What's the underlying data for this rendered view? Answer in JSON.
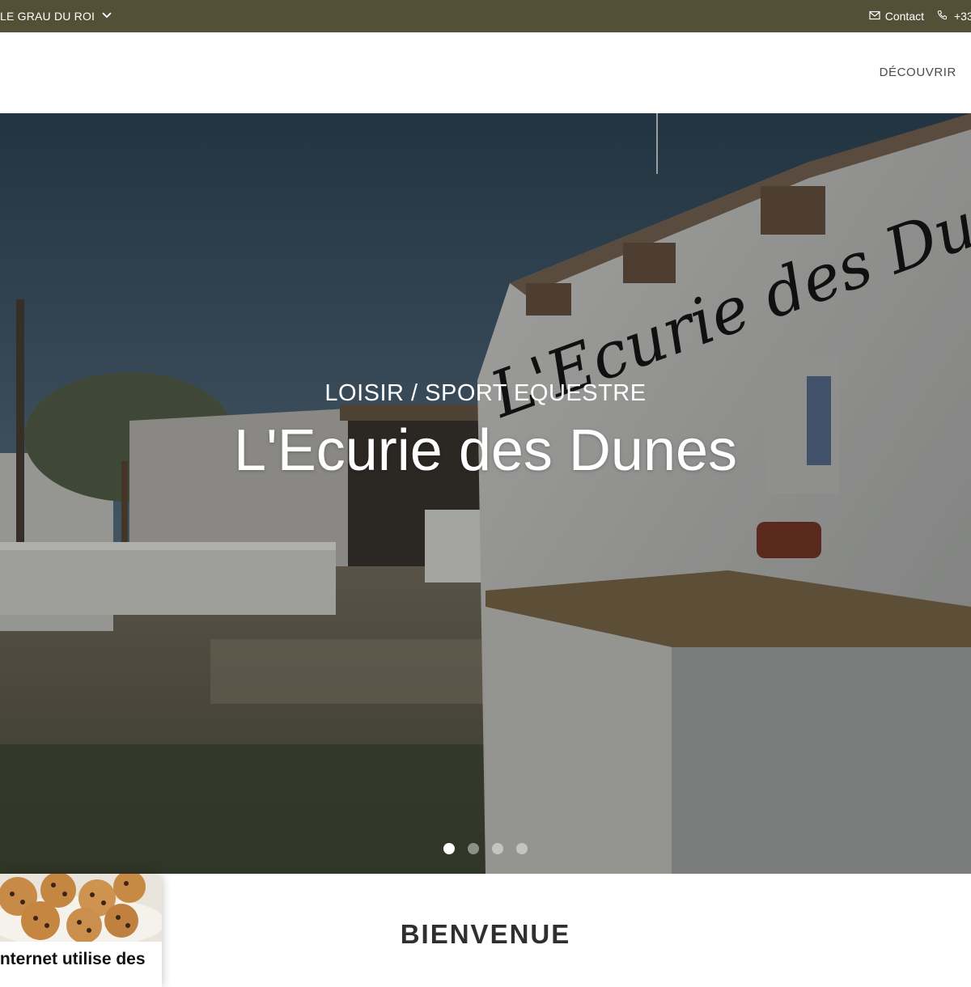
{
  "topbar": {
    "location_label": "LE GRAU DU ROI",
    "contact_label": "Contact",
    "phone_label": "+33"
  },
  "nav": {
    "discover_label": "DÉCOUVRIR"
  },
  "hero": {
    "kicker": "LOISIR / SPORT EQUESTRE",
    "title": "L'Ecurie des Dunes",
    "wall_sign": "L'Ecurie des Dunes",
    "slides": 4,
    "active_slide": 1
  },
  "section": {
    "welcome_title": "BIENVENUE"
  },
  "cookie_banner": {
    "text": "Internet utilise des"
  },
  "colors": {
    "topbar_bg": "#545038",
    "accent_white": "#ffffff"
  },
  "icons": {
    "location_chevron": "chevron-down-icon",
    "contact": "envelope-icon",
    "phone": "phone-icon"
  }
}
